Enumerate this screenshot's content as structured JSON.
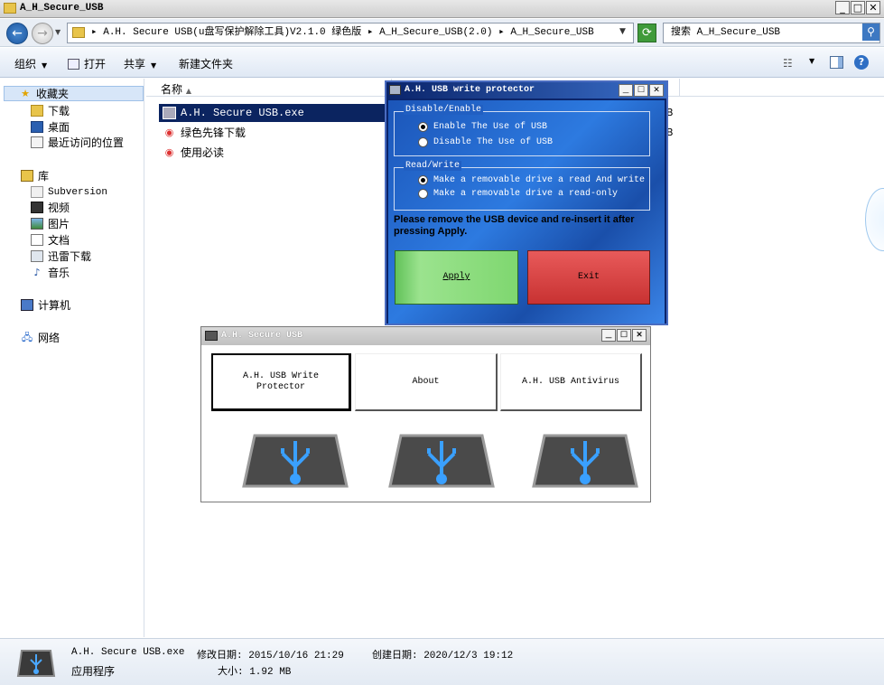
{
  "window": {
    "title": "A_H_Secure_USB"
  },
  "address": {
    "path": "▸ A.H. Secure USB(u盘写保护解除工具)V2.1.0 绿色版 ▸ A_H_Secure_USB(2.0) ▸ A_H_Secure_USB"
  },
  "search": {
    "placeholder": "搜索 A_H_Secure_USB"
  },
  "toolbar": {
    "organize": "组织",
    "open": "打开",
    "share": "共享",
    "new_folder": "新建文件夹"
  },
  "nav": {
    "favorites": "收藏夹",
    "downloads": "下载",
    "desktop": "桌面",
    "recent": "最近访问的位置",
    "libraries": "库",
    "subversion": "Subversion",
    "videos": "视频",
    "pictures": "图片",
    "documents": "文档",
    "xunlei": "迅雷下载",
    "music": "音乐",
    "computer": "计算机",
    "network": "网络"
  },
  "list": {
    "col_name": "名称",
    "files": [
      {
        "name": "A.H. Secure USB.exe",
        "size": "B"
      },
      {
        "name": "绿色先锋下载",
        "size": "B"
      },
      {
        "name": "使用必读",
        "size": ""
      }
    ]
  },
  "details": {
    "filename": "A.H. Secure USB.exe",
    "modified": "修改日期: 2015/10/16 21:29",
    "created": "创建日期: 2020/12/3 19:12",
    "type": "应用程序",
    "size": "大小: 1.92 MB"
  },
  "protector": {
    "title": "A.H. USB write protector",
    "group1_label": "Disable/Enable",
    "enable_label": "Enable The Use of USB",
    "disable_label": "Disable The Use of USB",
    "group2_label": "Read/Write",
    "readwrite_label": "Make a removable drive a read And write",
    "readonly_label": "Make a removable drive a read-only",
    "message": "Please remove the USB device and re-insert it after pressing Apply.",
    "apply": "Apply",
    "exit": "Exit"
  },
  "main": {
    "title": "A.H. Secure USB",
    "btn_protector": "A.H. USB Write Protector",
    "btn_about": "About",
    "btn_antivirus": "A.H. USB Antivirus"
  },
  "colors": {
    "selection": "#0b2460",
    "dialog_blue": "#1b55b8",
    "apply_green": "#7fd770",
    "exit_red": "#c83232"
  }
}
